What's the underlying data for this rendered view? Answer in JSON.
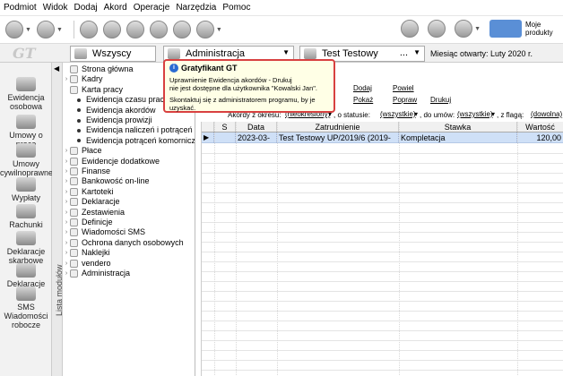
{
  "menu": [
    "Podmiot",
    "Widok",
    "Dodaj",
    "Akord",
    "Operacje",
    "Narzędzia",
    "Pomoc"
  ],
  "toolbar": {
    "moje_produkty": "Moje produkty"
  },
  "secondbar": {
    "logo": "GT",
    "combo_all": "Wszyscy",
    "combo_module": "Administracja",
    "combo_firm": "Test Testowy",
    "combo_firm_suffix": "...",
    "month_label": "Miesiąc otwarty: Luty 2020 r."
  },
  "left_nav": [
    {
      "label": "Ewidencja osobowa",
      "icon": "people-icon"
    },
    {
      "label": "Umowy o pracę",
      "icon": "contract-icon"
    },
    {
      "label": "Umowy cywilnoprawne",
      "icon": "contract-civil-icon"
    },
    {
      "label": "Wypłaty",
      "icon": "payout-icon"
    },
    {
      "label": "Rachunki",
      "icon": "bill-icon"
    },
    {
      "label": "Deklaracje skarbowe",
      "icon": "tax-declaration-icon"
    },
    {
      "label": "Deklaracje ZUS",
      "icon": "zus-declaration-icon"
    },
    {
      "label": "SMS Wiadomości robocze",
      "icon": "sms-icon"
    }
  ],
  "modules_tab_label": "Lista modułów",
  "tree": [
    {
      "label": "Strona główna",
      "level": 0
    },
    {
      "label": "Kadry",
      "level": 0
    },
    {
      "label": "Karta pracy",
      "level": 0
    },
    {
      "label": "Ewidencja czasu pracy",
      "level": 1
    },
    {
      "label": "Ewidencja akordów",
      "level": 1
    },
    {
      "label": "Ewidencja prowizji",
      "level": 1
    },
    {
      "label": "Ewidencja naliczeń i potrąceń",
      "level": 1
    },
    {
      "label": "Ewidencja potrąceń komorniczy",
      "level": 1
    },
    {
      "label": "Płace",
      "level": 0
    },
    {
      "label": "Ewidencje dodatkowe",
      "level": 0
    },
    {
      "label": "Finanse",
      "level": 0
    },
    {
      "label": "Bankowość on-line",
      "level": 0
    },
    {
      "label": "Kartoteki",
      "level": 0
    },
    {
      "label": "Deklaracje",
      "level": 0
    },
    {
      "label": "Zestawienia",
      "level": 0
    },
    {
      "label": "Definicje",
      "level": 0
    },
    {
      "label": "Wiadomości SMS",
      "level": 0
    },
    {
      "label": "Ochrona danych osobowych",
      "level": 0
    },
    {
      "label": "Naklejki",
      "level": 0
    },
    {
      "label": "vendero",
      "level": 0
    },
    {
      "label": "Administracja",
      "level": 0
    }
  ],
  "actions": {
    "dodaj": "Dodaj",
    "powiel": "Powiel",
    "pokaz": "Pokaż",
    "popraw": "Popraw",
    "drukuj": "Drukuj"
  },
  "filters": {
    "akordy_label": "Akordy z okresu:",
    "akordy_value": "(nieokreślony)",
    "status_label": ", o statusie:",
    "status_value": "(wszystkie)",
    "umow_label": ", do umów:",
    "umow_value": "(wszystkie)",
    "flaga_label": ", z flagą:",
    "flaga_value": "(dowolna)"
  },
  "grid": {
    "columns": [
      "",
      "S",
      "Data",
      "Zatrudnienie",
      "Stawka",
      "Wartość"
    ],
    "rows": [
      {
        "marker": "▶",
        "s": "",
        "data": "2023-03-",
        "zatrudnienie": "Test Testowy UP/2019/6 (2019-",
        "stawka": "Kompletacja",
        "wartosc": "120,00"
      }
    ]
  },
  "tooltip": {
    "title": "Gratyfikant GT",
    "line1": "Uprawnienie Ewidencja akordów - Drukuj",
    "line2": "nie jest dostępne dla użytkownika \"Kowalski Jan\".",
    "line3": "Skontaktuj się z administratorem programu, by je uzyskać."
  }
}
